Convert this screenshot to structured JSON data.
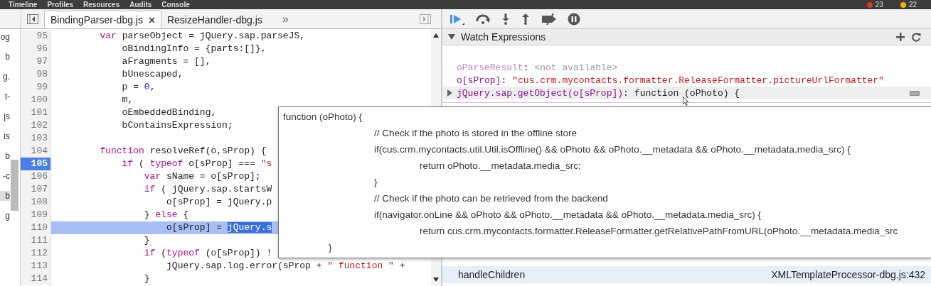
{
  "top_bar": {
    "menu": [
      "Timeline",
      "Profiles",
      "Resources",
      "Audits",
      "Console"
    ],
    "error_count": "23",
    "warning_count": "22"
  },
  "navigator": {
    "items": [
      {
        "label": "og",
        "selected": false
      },
      {
        "label": "b",
        "selected": false
      },
      {
        "label": "g.",
        "selected": false
      },
      {
        "label": "t-",
        "selected": false
      },
      {
        "label": "js",
        "selected": false
      },
      {
        "label": "is",
        "selected": false
      },
      {
        "label": "b",
        "selected": false
      },
      {
        "label": "-c",
        "selected": false
      },
      {
        "label": "b",
        "selected": true
      },
      {
        "label": "g",
        "selected": false
      }
    ]
  },
  "tabs": [
    {
      "label": "BindingParser-dbg.js",
      "selected": true,
      "closable": true
    },
    {
      "label": "ResizeHandler-dbg.js",
      "selected": false,
      "closable": false
    }
  ],
  "tabs_overflow": "»",
  "editor": {
    "lines": [
      {
        "number": "95",
        "breakpoint": false,
        "highlighted": false,
        "tokens": [
          {
            "text": "        var",
            "kind": "keyword"
          },
          {
            "text": " parseObject = jQuery.sap.parseJS,",
            "kind": "plain"
          }
        ]
      },
      {
        "number": "96",
        "breakpoint": false,
        "highlighted": false,
        "tokens": [
          {
            "text": "            oBindingInfo = {parts:[]},",
            "kind": "plain"
          }
        ]
      },
      {
        "number": "97",
        "breakpoint": false,
        "highlighted": false,
        "tokens": [
          {
            "text": "            aFragments = [],",
            "kind": "plain"
          }
        ]
      },
      {
        "number": "98",
        "breakpoint": false,
        "highlighted": false,
        "tokens": [
          {
            "text": "            bUnescaped,",
            "kind": "plain"
          }
        ]
      },
      {
        "number": "99",
        "breakpoint": false,
        "highlighted": false,
        "tokens": [
          {
            "text": "            p = ",
            "kind": "plain"
          },
          {
            "text": "0",
            "kind": "number"
          },
          {
            "text": ",",
            "kind": "plain"
          }
        ]
      },
      {
        "number": "100",
        "breakpoint": false,
        "highlighted": false,
        "tokens": [
          {
            "text": "            m,",
            "kind": "plain"
          }
        ]
      },
      {
        "number": "101",
        "breakpoint": false,
        "highlighted": false,
        "tokens": [
          {
            "text": "            oEmbeddedBinding,",
            "kind": "plain"
          }
        ]
      },
      {
        "number": "102",
        "breakpoint": false,
        "highlighted": false,
        "tokens": [
          {
            "text": "            bContainsExpression;",
            "kind": "plain"
          }
        ]
      },
      {
        "number": "103",
        "breakpoint": false,
        "highlighted": false
      },
      {
        "number": "104",
        "breakpoint": false,
        "highlighted": false,
        "tokens": [
          {
            "text": "        function",
            "kind": "keyword"
          },
          {
            "text": " resolveRef(o,sProp) {",
            "kind": "plain"
          }
        ]
      },
      {
        "number": "105",
        "breakpoint": true,
        "highlighted": false,
        "tokens": [
          {
            "text": "            if",
            "kind": "keyword"
          },
          {
            "text": " ( ",
            "kind": "plain"
          },
          {
            "text": "typeof",
            "kind": "keyword"
          },
          {
            "text": " o[sProp] === ",
            "kind": "plain"
          },
          {
            "text": "\"s",
            "kind": "string"
          }
        ]
      },
      {
        "number": "106",
        "breakpoint": false,
        "highlighted": false,
        "tokens": [
          {
            "text": "                var",
            "kind": "keyword"
          },
          {
            "text": " sName = o[sProp];",
            "kind": "plain"
          }
        ]
      },
      {
        "number": "107",
        "breakpoint": false,
        "highlighted": false,
        "tokens": [
          {
            "text": "                if",
            "kind": "keyword"
          },
          {
            "text": " ( jQuery.sap.startsW",
            "kind": "plain"
          }
        ]
      },
      {
        "number": "108",
        "breakpoint": false,
        "highlighted": false,
        "tokens": [
          {
            "text": "                    o[sProp] = jQuery.p",
            "kind": "plain"
          }
        ]
      },
      {
        "number": "109",
        "breakpoint": false,
        "highlighted": false,
        "tokens": [
          {
            "text": "                } ",
            "kind": "plain"
          },
          {
            "text": "else",
            "kind": "keyword"
          },
          {
            "text": " {",
            "kind": "plain"
          }
        ]
      },
      {
        "number": "110",
        "breakpoint": false,
        "highlighted": true,
        "tokens": [
          {
            "text": "                    o[sProp] = ",
            "kind": "plain"
          },
          {
            "text": "jQuery.s",
            "kind": "selection"
          }
        ]
      },
      {
        "number": "111",
        "breakpoint": false,
        "highlighted": false,
        "tokens": [
          {
            "text": "                }",
            "kind": "plain"
          }
        ]
      },
      {
        "number": "112",
        "breakpoint": false,
        "highlighted": false,
        "tokens": [
          {
            "text": "                if",
            "kind": "keyword"
          },
          {
            "text": " (",
            "kind": "plain"
          },
          {
            "text": "typeof",
            "kind": "keyword"
          },
          {
            "text": " (o[sProp]) !",
            "kind": "plain"
          }
        ]
      },
      {
        "number": "113",
        "breakpoint": false,
        "highlighted": false,
        "tokens": [
          {
            "text": "                    jQuery.sap.log.error(sProp + ",
            "kind": "plain"
          },
          {
            "text": "\" function \"",
            "kind": "string"
          },
          {
            "text": " +",
            "kind": "plain"
          }
        ]
      },
      {
        "number": "114",
        "breakpoint": false,
        "highlighted": false,
        "tokens": [
          {
            "text": "                }",
            "kind": "plain"
          }
        ]
      }
    ]
  },
  "tooltip": {
    "lines": [
      "function (oPhoto) {",
      "\t\t// Check if the photo is stored in the offline store",
      "\t\tif(cus.crm.mycontacts.util.Util.isOffline() && oPhoto && oPhoto.__metadata && oPhoto.__metadata.media_src) {",
      "\t\t\treturn oPhoto.__metadata.media_src;",
      "\t\t}",
      "\t\t// Check if the photo can be retrieved from the backend",
      "\t\tif(navigator.onLine && oPhoto && oPhoto.__metadata && oPhoto.__metadata.media_src) {",
      "\t\t\treturn cus.crm.mycontacts.formatter.ReleaseFormatter.getRelativePathFromURL(oPhoto.__metadata.media_src",
      "\t}"
    ]
  },
  "watch": {
    "title": "Watch Expressions",
    "expanded": true,
    "items": [
      {
        "name": "oParseResult",
        "separator": ":",
        "value": "<not available>",
        "kind": "unavailable",
        "expandable": false,
        "hovered": false
      },
      {
        "name": "o[sProp]",
        "separator": ":",
        "value": "\"cus.crm.mycontacts.formatter.ReleaseFormatter.pictureUrlFormatter\"",
        "kind": "string",
        "expandable": false,
        "hovered": false
      },
      {
        "name": "jQuery.sap.getObject(o[sProp])",
        "separator": ":",
        "value": "function (oPhoto) {",
        "kind": "function",
        "expandable": true,
        "hovered": true
      }
    ]
  },
  "call_stack": {
    "items": [
      {
        "name": "handleChildren",
        "location": "XMLTemplateProcessor-dbg.js:432",
        "selected": true
      }
    ]
  }
}
